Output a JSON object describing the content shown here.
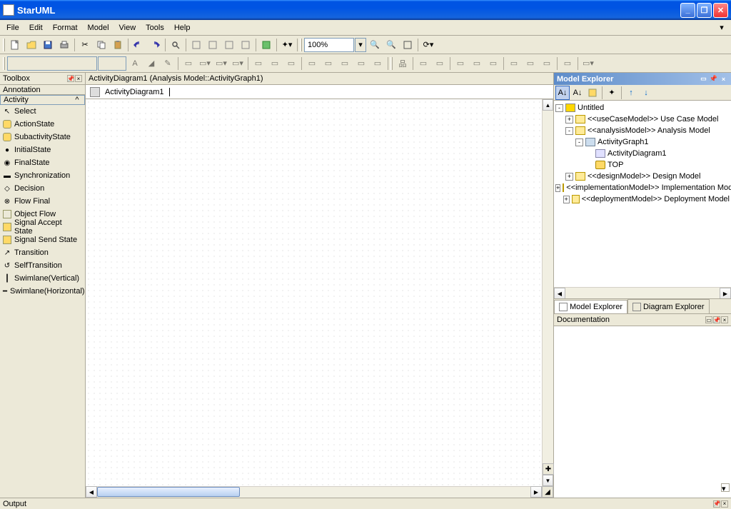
{
  "window": {
    "title": "StarUML"
  },
  "menubar": {
    "file": "File",
    "edit": "Edit",
    "format": "Format",
    "model": "Model",
    "view": "View",
    "tools": "Tools",
    "help": "Help"
  },
  "toolbar": {
    "zoom": "100%"
  },
  "toolbox": {
    "title": "Toolbox",
    "sections": {
      "annotation": "Annotation",
      "activity": "Activity"
    },
    "items": [
      "Select",
      "ActionState",
      "SubactivityState",
      "InitialState",
      "FinalState",
      "Synchronization",
      "Decision",
      "Flow Final",
      "Object Flow",
      "Signal Accept State",
      "Signal Send State",
      "Transition",
      "SelfTransition",
      "Swimlane(Vertical)",
      "Swimlane(Horizontal)"
    ]
  },
  "canvas": {
    "tab_header": "ActivityDiagram1 (Analysis Model::ActivityGraph1)",
    "crumb": "ActivityDiagram1"
  },
  "model_explorer": {
    "title": "Model Explorer",
    "tree": {
      "root": "Untitled",
      "usecase": "<<useCaseModel>> Use Case Model",
      "analysis": "<<analysisModel>> Analysis Model",
      "activity_graph": "ActivityGraph1",
      "activity_diagram": "ActivityDiagram1",
      "top": "TOP",
      "design": "<<designModel>> Design Model",
      "implementation": "<<implementationModel>> Implementation Model",
      "deployment": "<<deploymentModel>> Deployment Model"
    },
    "tabs": {
      "model": "Model Explorer",
      "diagram": "Diagram Explorer"
    }
  },
  "documentation": {
    "title": "Documentation"
  },
  "output": {
    "title": "Output"
  }
}
